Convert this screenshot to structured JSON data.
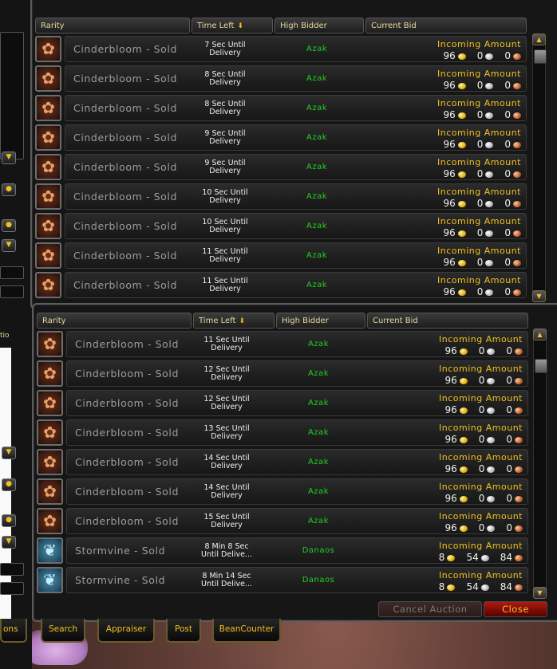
{
  "columns": {
    "rarity": "Rarity",
    "time_left": "Time Left",
    "high_bidder": "High Bidder",
    "current_bid": "Current Bid"
  },
  "colors": {
    "bidder_green": "#20d020",
    "incoming_gold": "#f0c020",
    "item_gray": "#9d9d9d"
  },
  "top_rows": [
    {
      "name": "Cinderbloom - Sold",
      "time": "7 Sec Until\nDelivery",
      "bidder": "Azak",
      "label": "Incoming Amount",
      "gold": "96",
      "silver": "0",
      "copper": "0",
      "icon": "cinderbloom-icon"
    },
    {
      "name": "Cinderbloom - Sold",
      "time": "8 Sec Until\nDelivery",
      "bidder": "Azak",
      "label": "Incoming Amount",
      "gold": "96",
      "silver": "0",
      "copper": "0",
      "icon": "cinderbloom-icon"
    },
    {
      "name": "Cinderbloom - Sold",
      "time": "8 Sec Until\nDelivery",
      "bidder": "Azak",
      "label": "Incoming Amount",
      "gold": "96",
      "silver": "0",
      "copper": "0",
      "icon": "cinderbloom-icon"
    },
    {
      "name": "Cinderbloom - Sold",
      "time": "9 Sec Until\nDelivery",
      "bidder": "Azak",
      "label": "Incoming Amount",
      "gold": "96",
      "silver": "0",
      "copper": "0",
      "icon": "cinderbloom-icon"
    },
    {
      "name": "Cinderbloom - Sold",
      "time": "9 Sec Until\nDelivery",
      "bidder": "Azak",
      "label": "Incoming Amount",
      "gold": "96",
      "silver": "0",
      "copper": "0",
      "icon": "cinderbloom-icon"
    },
    {
      "name": "Cinderbloom - Sold",
      "time": "10 Sec Until\nDelivery",
      "bidder": "Azak",
      "label": "Incoming Amount",
      "gold": "96",
      "silver": "0",
      "copper": "0",
      "icon": "cinderbloom-icon"
    },
    {
      "name": "Cinderbloom - Sold",
      "time": "10 Sec Until\nDelivery",
      "bidder": "Azak",
      "label": "Incoming Amount",
      "gold": "96",
      "silver": "0",
      "copper": "0",
      "icon": "cinderbloom-icon"
    },
    {
      "name": "Cinderbloom - Sold",
      "time": "11 Sec Until\nDelivery",
      "bidder": "Azak",
      "label": "Incoming Amount",
      "gold": "96",
      "silver": "0",
      "copper": "0",
      "icon": "cinderbloom-icon"
    },
    {
      "name": "Cinderbloom - Sold",
      "time": "11 Sec Until\nDelivery",
      "bidder": "Azak",
      "label": "Incoming Amount",
      "gold": "96",
      "silver": "0",
      "copper": "0",
      "icon": "cinderbloom-icon"
    }
  ],
  "bottom_rows": [
    {
      "name": "Cinderbloom - Sold",
      "time": "11 Sec Until\nDelivery",
      "bidder": "Azak",
      "label": "Incoming Amount",
      "gold": "96",
      "silver": "0",
      "copper": "0",
      "icon": "cinderbloom-icon"
    },
    {
      "name": "Cinderbloom - Sold",
      "time": "12 Sec Until\nDelivery",
      "bidder": "Azak",
      "label": "Incoming Amount",
      "gold": "96",
      "silver": "0",
      "copper": "0",
      "icon": "cinderbloom-icon"
    },
    {
      "name": "Cinderbloom - Sold",
      "time": "12 Sec Until\nDelivery",
      "bidder": "Azak",
      "label": "Incoming Amount",
      "gold": "96",
      "silver": "0",
      "copper": "0",
      "icon": "cinderbloom-icon"
    },
    {
      "name": "Cinderbloom - Sold",
      "time": "13 Sec Until\nDelivery",
      "bidder": "Azak",
      "label": "Incoming Amount",
      "gold": "96",
      "silver": "0",
      "copper": "0",
      "icon": "cinderbloom-icon"
    },
    {
      "name": "Cinderbloom - Sold",
      "time": "14 Sec Until\nDelivery",
      "bidder": "Azak",
      "label": "Incoming Amount",
      "gold": "96",
      "silver": "0",
      "copper": "0",
      "icon": "cinderbloom-icon"
    },
    {
      "name": "Cinderbloom - Sold",
      "time": "14 Sec Until\nDelivery",
      "bidder": "Azak",
      "label": "Incoming Amount",
      "gold": "96",
      "silver": "0",
      "copper": "0",
      "icon": "cinderbloom-icon"
    },
    {
      "name": "Cinderbloom - Sold",
      "time": "15 Sec Until\nDelivery",
      "bidder": "Azak",
      "label": "Incoming Amount",
      "gold": "96",
      "silver": "0",
      "copper": "0",
      "icon": "cinderbloom-icon"
    },
    {
      "name": "Stormvine - Sold",
      "time": "8 Min 8 Sec\nUntil Delive...",
      "bidder": "Danaos",
      "label": "Incoming Amount",
      "gold": "8",
      "silver": "54",
      "copper": "84",
      "icon": "stormvine-icon"
    },
    {
      "name": "Stormvine - Sold",
      "time": "8 Min 14 Sec\nUntil Delive...",
      "bidder": "Danaos",
      "label": "Incoming Amount",
      "gold": "8",
      "silver": "54",
      "copper": "84",
      "icon": "stormvine-icon"
    }
  ],
  "buttons": {
    "cancel_auction": "Cancel Auction",
    "close": "Close"
  },
  "tabs": [
    {
      "label": "ons"
    },
    {
      "label": "Search"
    },
    {
      "label": "Appraiser"
    },
    {
      "label": "Post"
    },
    {
      "label": "BeanCounter"
    }
  ],
  "side_fragments": {
    "bottom_cut_label": "tio"
  }
}
